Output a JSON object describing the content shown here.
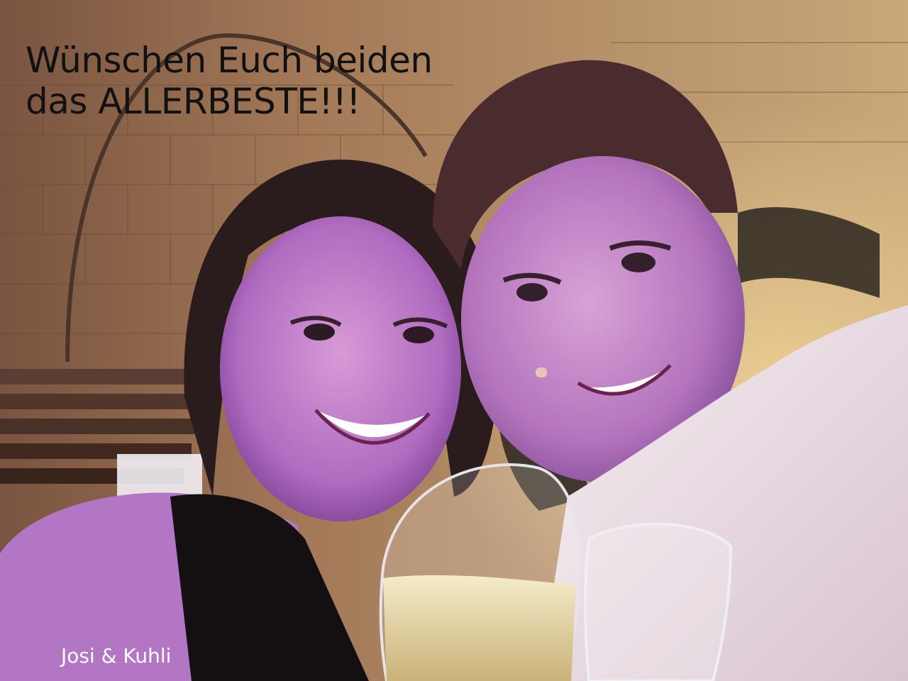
{
  "greeting": {
    "line1": "Wünschen Euch beiden",
    "line2": "das ALLERBESTE!!!"
  },
  "signature": "Josi & Kuhli",
  "palette": {
    "wall_warm": "#b5865a",
    "wall_dark": "#5a3a2a",
    "skin_purple": "#c07ac8",
    "shirt": "#efe4e8",
    "dress": "#141012",
    "hair": "#2a1c1c",
    "wine": "#e9dca8"
  }
}
